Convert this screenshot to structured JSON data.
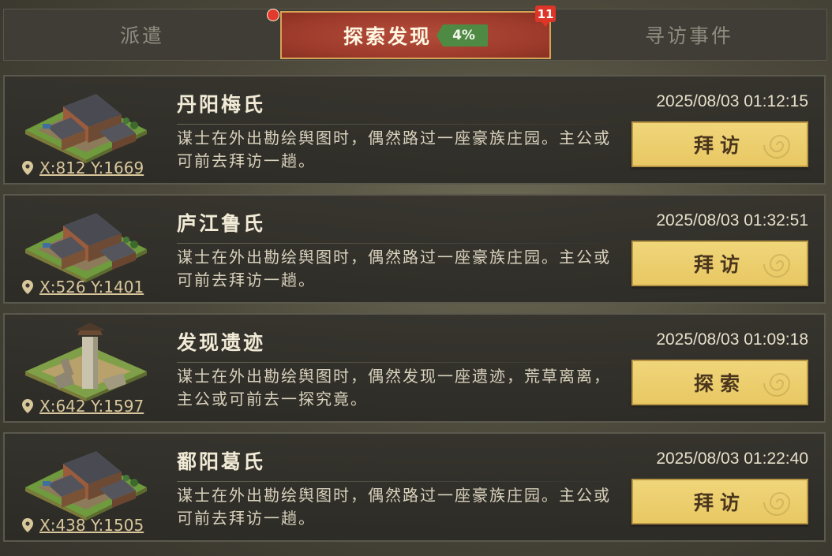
{
  "tabs": {
    "dispatch": "派遣",
    "explore": "探索发现",
    "explore_pct": "4%",
    "explore_badge": "11",
    "events": "寻访事件"
  },
  "cards": [
    {
      "title": "丹阳梅氏",
      "time": "2025/08/03 01:12:15",
      "desc": "谋士在外出勘绘舆图时，偶然路过一座豪族庄园。主公或可前去拜访一趟。",
      "coords": "X:812 Y:1669",
      "action": "拜访",
      "icon": "manor-icon"
    },
    {
      "title": "庐江鲁氏",
      "time": "2025/08/03 01:32:51",
      "desc": "谋士在外出勘绘舆图时，偶然路过一座豪族庄园。主公或可前去拜访一趟。",
      "coords": "X:526 Y:1401",
      "action": "拜访",
      "icon": "manor-icon"
    },
    {
      "title": "发现遗迹",
      "time": "2025/08/03 01:09:18",
      "desc": "谋士在外出勘绘舆图时，偶然发现一座遗迹，荒草离离，主公或可前去一探究竟。",
      "coords": "X:642 Y:1597",
      "action": "探索",
      "icon": "ruins-icon"
    },
    {
      "title": "鄱阳葛氏",
      "time": "2025/08/03 01:22:40",
      "desc": "谋士在外出勘绘舆图时，偶然路过一座豪族庄园。主公或可前去拜访一趟。",
      "coords": "X:438 Y:1505",
      "action": "拜访",
      "icon": "manor-icon"
    }
  ],
  "colors": {
    "tab_active": "#9c3a2b",
    "button": "#e8c863",
    "badge": "#dd3527",
    "percent": "#4f8a45"
  }
}
